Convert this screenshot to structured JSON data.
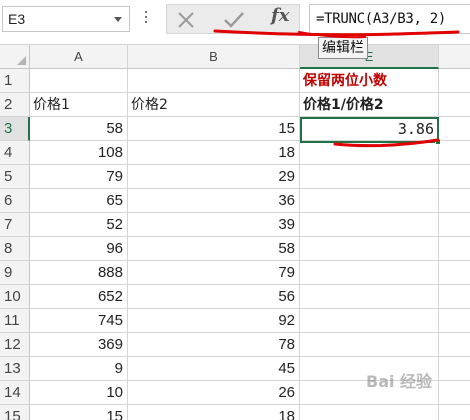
{
  "formula_bar": {
    "name_box": "E3",
    "fx_label": "fx",
    "formula": "=TRUNC(A3/B3, 2)",
    "tooltip": "编辑栏"
  },
  "columns": [
    {
      "label": "",
      "active": false
    },
    {
      "label": "A",
      "active": false
    },
    {
      "label": "B",
      "active": false
    },
    {
      "label": "E",
      "active": true
    }
  ],
  "rows": [
    {
      "num": "1",
      "a": "",
      "b": "",
      "e": "保留两位小数",
      "active": false
    },
    {
      "num": "2",
      "a": "价格1",
      "b": "价格2",
      "e": "价格1/价格2",
      "active": false
    },
    {
      "num": "3",
      "a": "58",
      "b": "15",
      "e": "3.86",
      "active": true
    },
    {
      "num": "4",
      "a": "108",
      "b": "18",
      "e": "",
      "active": false
    },
    {
      "num": "5",
      "a": "79",
      "b": "29",
      "e": "",
      "active": false
    },
    {
      "num": "6",
      "a": "65",
      "b": "36",
      "e": "",
      "active": false
    },
    {
      "num": "7",
      "a": "52",
      "b": "39",
      "e": "",
      "active": false
    },
    {
      "num": "8",
      "a": "96",
      "b": "58",
      "e": "",
      "active": false
    },
    {
      "num": "9",
      "a": "888",
      "b": "79",
      "e": "",
      "active": false
    },
    {
      "num": "10",
      "a": "652",
      "b": "56",
      "e": "",
      "active": false
    },
    {
      "num": "11",
      "a": "745",
      "b": "92",
      "e": "",
      "active": false
    },
    {
      "num": "12",
      "a": "369",
      "b": "78",
      "e": "",
      "active": false
    },
    {
      "num": "13",
      "a": "9",
      "b": "45",
      "e": "",
      "active": false
    },
    {
      "num": "14",
      "a": "10",
      "b": "26",
      "e": "",
      "active": false
    },
    {
      "num": "15",
      "a": "15",
      "b": "18",
      "e": "",
      "active": false
    }
  ],
  "watermark": "Bai 经验",
  "colors": {
    "accent_green": "#217346",
    "annotation_red": "#e00000",
    "note_red": "#c00000"
  }
}
